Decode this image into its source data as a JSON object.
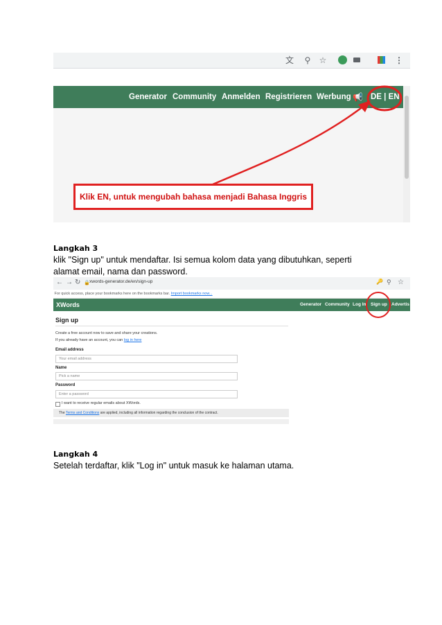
{
  "shot1": {
    "nav": [
      "Generator",
      "Community",
      "Anmelden",
      "Registrieren",
      "Werbung"
    ],
    "lang": "DE | EN",
    "callout": "Klik EN, untuk mengubah bahasa menjadi Bahasa Inggris",
    "icons": [
      "translate-icon",
      "zoom-icon",
      "star-icon",
      "profile-icon",
      "camera-icon",
      "extension-icon",
      "menu-icon",
      "megaphone-icon"
    ]
  },
  "step3": {
    "heading": "Langkah 3",
    "line1": "klik \"Sign up\" untuk mendaftar. Isi semua kolom data yang dibutuhkan, seperti",
    "line2": "alamat email, nama dan password."
  },
  "shot2": {
    "url": "xwords-generator.de/en/sign-up",
    "bookmarks_text": "For quick access, place your bookmarks here on the bookmarks bar.",
    "bookmarks_link": "Import bookmarks now...",
    "brand": "XWords",
    "nav": [
      "Generator",
      "Community",
      "Log In",
      "Sign up",
      "Advertis"
    ],
    "title": "Sign up",
    "intro": "Create a free account now to save and share your creations.",
    "login_prefix": "If you already have an account, you can",
    "login_link": "log in here",
    "email_label": "Email address",
    "email_placeholder": "Your email address",
    "name_label": "Name",
    "name_placeholder": "Pick a name",
    "password_label": "Password",
    "password_placeholder": "Enter a password",
    "newsletter": "I want to receive regular emails about XWords.",
    "terms_prefix": "The",
    "terms_link": "Terms and Conditions",
    "terms_suffix": "are applied, including all information regarding the conclusion of the contract."
  },
  "step4": {
    "heading": "Langkah 4",
    "line1": "Setelah terdaftar, klik \"Log in\" untuk masuk ke halaman utama."
  },
  "colors": {
    "nav_green": "#3f7d5a",
    "highlight_red": "#e02020"
  }
}
